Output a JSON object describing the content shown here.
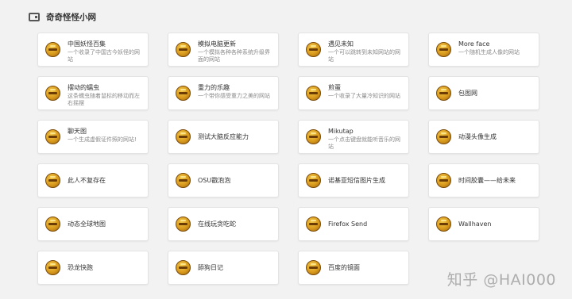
{
  "header": {
    "title": "奇奇怪怪小网"
  },
  "cards": [
    {
      "title": "中国妖怪百集",
      "desc": "一个收录了中国古今妖怪的网站"
    },
    {
      "title": "模拟电脑更新",
      "desc": "一个模拟各种各种系统升级界面的网站"
    },
    {
      "title": "遇见未知",
      "desc": "一个可以跳转到未知网站的网站"
    },
    {
      "title": "More face",
      "desc": "一个随机生成人像的网站"
    },
    {
      "title": "摆动的蠕虫",
      "desc": "这条蠕虫随着鼠标的移动而左右摇摆"
    },
    {
      "title": "重力的乐趣",
      "desc": "一个带你感受重力之美的网站"
    },
    {
      "title": "煎蛋",
      "desc": "一个收录了大量冷知识的网站"
    },
    {
      "title": "包图网",
      "desc": ""
    },
    {
      "title": "聊天图",
      "desc": "一个生成虚假证件照的网站!"
    },
    {
      "title": "测试大脑反应能力",
      "desc": ""
    },
    {
      "title": "Mikutap",
      "desc": "一个点击键盘就能听音乐的网站"
    },
    {
      "title": "动漫头像生成",
      "desc": ""
    },
    {
      "title": "此人不复存在",
      "desc": ""
    },
    {
      "title": "OSU戳泡泡",
      "desc": ""
    },
    {
      "title": "诺基亚短信图片生成",
      "desc": ""
    },
    {
      "title": "时间胶囊——给未来",
      "desc": ""
    },
    {
      "title": "动态全球地图",
      "desc": ""
    },
    {
      "title": "在线玩贪吃蛇",
      "desc": ""
    },
    {
      "title": "Firefox Send",
      "desc": ""
    },
    {
      "title": "Wallhaven",
      "desc": ""
    },
    {
      "title": "恐龙快跑",
      "desc": ""
    },
    {
      "title": "舔狗日记",
      "desc": ""
    },
    {
      "title": "百度的镜面",
      "desc": ""
    }
  ],
  "watermark": "知乎 @HAI000"
}
